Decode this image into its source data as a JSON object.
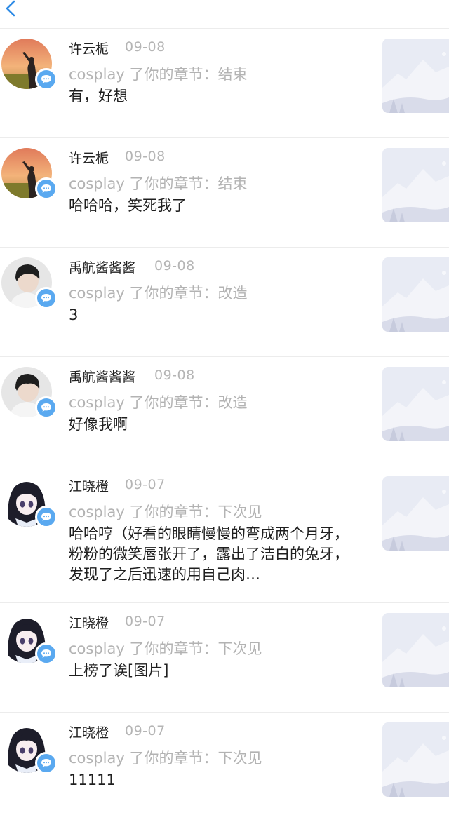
{
  "header": {
    "back_icon": "chevron-left-icon"
  },
  "colors": {
    "accent": "#5aa9f0",
    "meta": "#b3b3b3",
    "divider": "#ececec"
  },
  "comments": [
    {
      "avatar": "sunset-avatar",
      "name": "许云栀",
      "date": "09-08",
      "reply": "cosplay 了你的章节：结束",
      "text": "有，好想",
      "thumb": "image-placeholder"
    },
    {
      "avatar": "sunset-avatar",
      "name": "许云栀",
      "date": "09-08",
      "reply": "cosplay 了你的章节：结束",
      "text": "哈哈哈，笑死我了",
      "thumb": "image-placeholder"
    },
    {
      "avatar": "boy-avatar",
      "name": "禹航酱酱酱",
      "date": "09-08",
      "reply": "cosplay 了你的章节：改造",
      "text": "3",
      "thumb": "image-placeholder"
    },
    {
      "avatar": "boy-avatar",
      "name": "禹航酱酱酱",
      "date": "09-08",
      "reply": "cosplay 了你的章节：改造",
      "text": "好像我啊",
      "thumb": "image-placeholder"
    },
    {
      "avatar": "anime-girl-avatar",
      "name": "江晓橙",
      "date": "09-07",
      "reply": "cosplay 了你的章节：下次见",
      "text": "哈哈哼（好看的眼睛慢慢的弯成两个月牙，粉粉的微笑唇张开了，露出了洁白的兔牙，发现了之后迅速的用自己肉…",
      "thumb": "image-placeholder"
    },
    {
      "avatar": "anime-girl-avatar",
      "name": "江晓橙",
      "date": "09-07",
      "reply": "cosplay 了你的章节：下次见",
      "text": "上榜了诶[图片]",
      "thumb": "image-placeholder"
    },
    {
      "avatar": "anime-girl-avatar",
      "name": "江晓橙",
      "date": "09-07",
      "reply": "cosplay 了你的章节：下次见",
      "text": "11111",
      "thumb": "image-placeholder"
    }
  ]
}
